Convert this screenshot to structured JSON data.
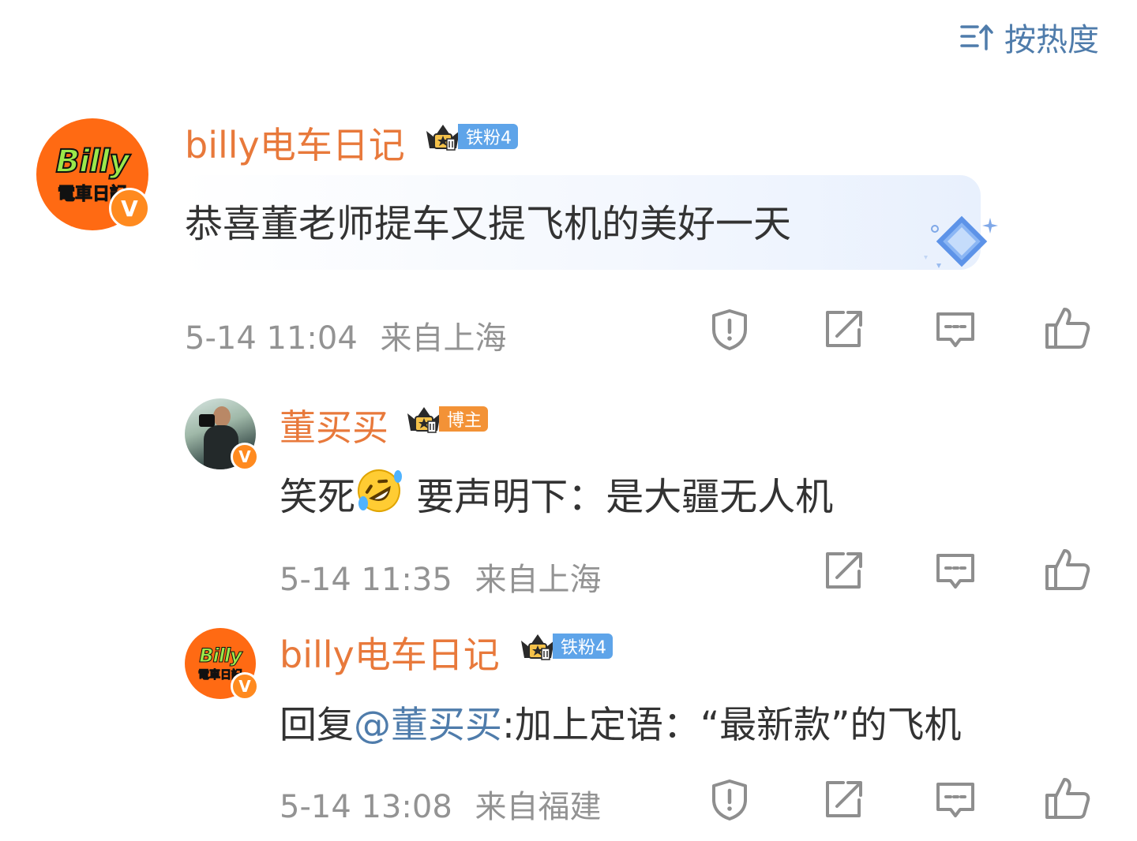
{
  "header": {
    "sort_icon": "sort-icon",
    "sort_label": "按热度"
  },
  "comments": [
    {
      "author": "billy电车日记",
      "avatar_logo_top": "Billy",
      "avatar_logo_bottom": "電車日記",
      "verified": "V",
      "fan_badge": "铁粉4",
      "text": "恭喜董老师提车又提飞机的美好一天",
      "time": "5-14 11:04",
      "location": "来自上海"
    },
    {
      "author": "董买买",
      "verified": "V",
      "fan_badge": "博主",
      "text_before": "笑死",
      "emoji": "rolling-on-floor-laughing-emoji",
      "text_after": "要声明下：是大疆无人机",
      "time": "5-14 11:35",
      "location": "来自上海"
    },
    {
      "author": "billy电车日记",
      "avatar_logo_top": "Billy",
      "avatar_logo_bottom": "電車日記",
      "verified": "V",
      "fan_badge": "铁粉4",
      "text_prefix": "回复",
      "mention": "@董买买",
      "text_body": ":加上定语：“最新款”的飞机",
      "time": "5-14 13:08",
      "location": "来自福建"
    }
  ],
  "colors": {
    "name": "#e8793b",
    "mention": "#4f7cab",
    "meta": "#939393",
    "fan_blue": "#5ea4e9",
    "fan_orange": "#f39236",
    "avatar_orange": "#ff6a13"
  }
}
